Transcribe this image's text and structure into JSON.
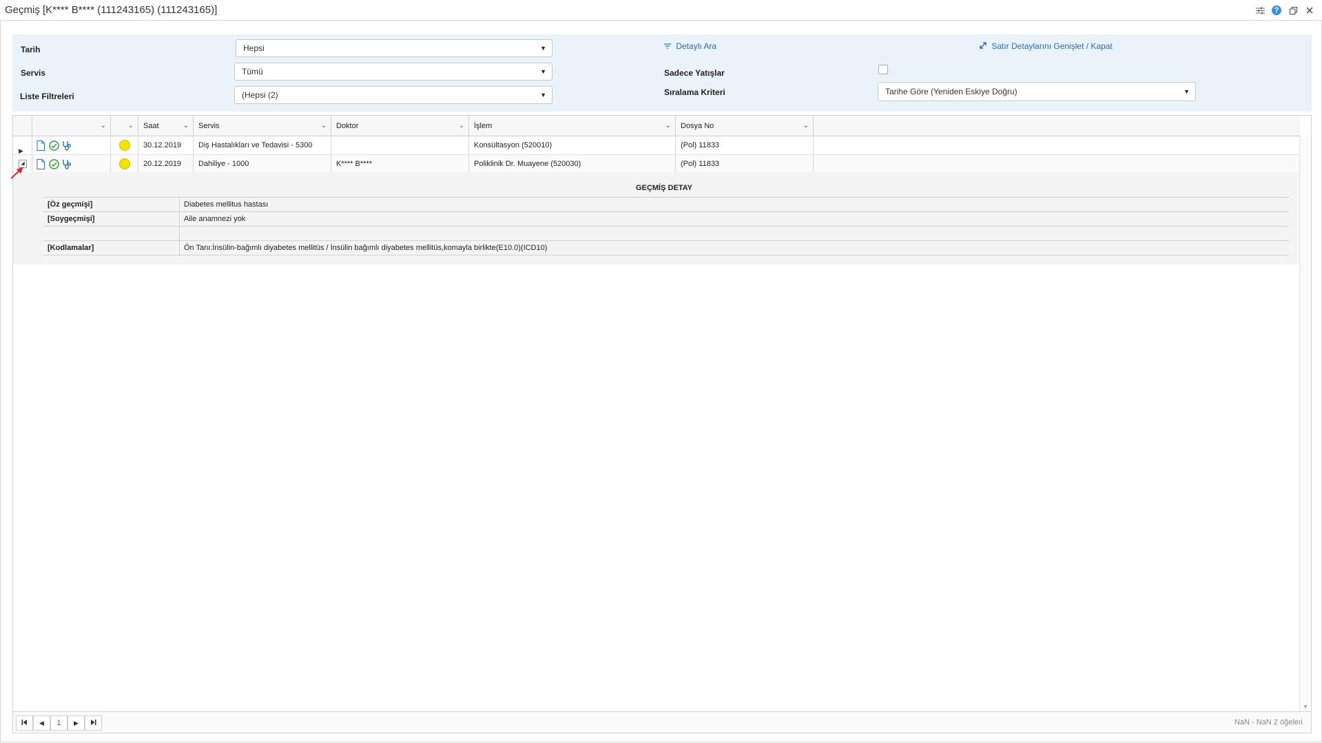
{
  "window": {
    "title": "Geçmiş [K**** B**** (111243165) (111243165)]"
  },
  "filters": {
    "tarih_label": "Tarih",
    "tarih_value": "Hepsi",
    "servis_label": "Servis",
    "servis_value": "Tümü",
    "liste_label": "Liste Filtreleri",
    "liste_value": "(Hepsi (2)",
    "detayli_ara": "Detaylı Ara",
    "satir_detay": "Satır Detaylarını Genişlet / Kapat",
    "sadece_yatislar_label": "Sadece Yatışlar",
    "siralama_label": "Sıralama Kriteri",
    "siralama_value": "Tarihe Göre (Yeniden Eskiye Doğru)"
  },
  "grid": {
    "columns": [
      "",
      "",
      "Saat",
      "Servis",
      "Doktor",
      "İşlem",
      "Dosya No"
    ],
    "rows": [
      {
        "saat": "30.12.2019",
        "servis": "Diş Hastalıkları ve Tedavisi - 5300",
        "doktor": "",
        "islem": "Konsültasyon (520010)",
        "dosya": "(Pol) 11833",
        "status_color": "#f2e600",
        "expanded": false
      },
      {
        "saat": "20.12.2019",
        "servis": "Dahiliye - 1000",
        "doktor": "K**** B****",
        "islem": "Poliklinik Dr. Muayene (520030)",
        "dosya": "(Pol) 11833",
        "status_color": "#f2e600",
        "expanded": true
      }
    ]
  },
  "detail": {
    "title": "GEÇMİŞ DETAY",
    "rows": [
      {
        "key": "[Öz geçmişi]",
        "value": "Diabetes mellitus hastası"
      },
      {
        "key": "[Soygeçmişi]",
        "value": "Aile anamnezi yok"
      },
      {
        "key": "",
        "value": ""
      },
      {
        "key": "[Kodlamalar]",
        "value": "Ön Tanı:İnsülin-bağımlı diyabetes mellitüs / İnsülin bağımlı diyabetes mellitüs,komayla birlikte(E10.0)(ICD10)"
      }
    ]
  },
  "pager": {
    "page": "1",
    "info": "NaN - NaN 2 öğeleri"
  },
  "icons": [
    "settings-icon",
    "help-icon",
    "restore-icon",
    "close-icon",
    "document-icon",
    "check-circle-icon",
    "stethoscope-icon",
    "filter-icon",
    "expand-icon"
  ],
  "colors": {
    "accent": "#2a6cb7",
    "filter_bg": "#eaf2fa",
    "status_yellow": "#f2e600"
  }
}
